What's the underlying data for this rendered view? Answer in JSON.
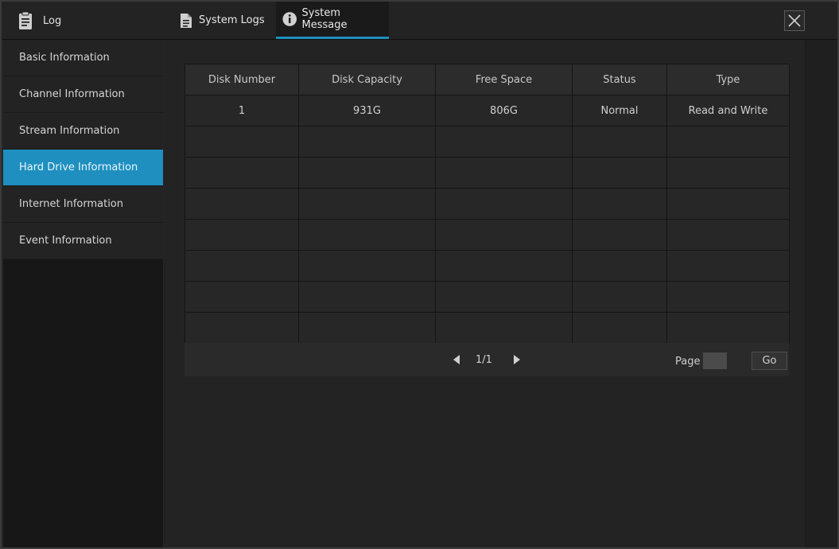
{
  "header": {
    "title": "Log",
    "tabs": [
      {
        "label": "System Logs",
        "icon": "document-icon"
      },
      {
        "label": "System Message",
        "icon": "info-icon"
      }
    ],
    "active_tab": "System Message"
  },
  "sidebar": {
    "items": [
      {
        "label": "Basic Information"
      },
      {
        "label": "Channel Information"
      },
      {
        "label": "Stream Information"
      },
      {
        "label": "Hard Drive Information"
      },
      {
        "label": "Internet Information"
      },
      {
        "label": "Event Information"
      }
    ],
    "active": "Hard Drive Information"
  },
  "table": {
    "columns": [
      "Disk Number",
      "Disk Capacity",
      "Free Space",
      "Status",
      "Type"
    ],
    "rows": [
      [
        "1",
        "931G",
        "806G",
        "Normal",
        "Read and Write"
      ],
      [
        "",
        "",
        "",
        "",
        ""
      ],
      [
        "",
        "",
        "",
        "",
        ""
      ],
      [
        "",
        "",
        "",
        "",
        ""
      ],
      [
        "",
        "",
        "",
        "",
        ""
      ],
      [
        "",
        "",
        "",
        "",
        ""
      ],
      [
        "",
        "",
        "",
        "",
        ""
      ],
      [
        "",
        "",
        "",
        "",
        ""
      ]
    ]
  },
  "pagination": {
    "current": "1/1",
    "page_label": "Page",
    "page_input": "",
    "go_label": "Go"
  },
  "colors": {
    "accent": "#1e8fbf",
    "background": "#232323"
  }
}
